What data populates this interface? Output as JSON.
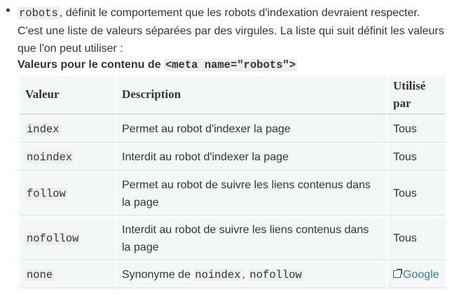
{
  "intro": {
    "code": "robots",
    "line1_rest": ", définit le comportement que les robots d'indexation devraient respecter.",
    "line2": "C'est une liste de valeurs séparées par des virgules. La liste qui suit définit les valeurs que l'on peut utiliser :"
  },
  "caption": {
    "prefix": "Valeurs pour le contenu de ",
    "code": "<meta name=\"robots\">"
  },
  "table": {
    "headers": [
      "Valeur",
      "Description",
      "Utilisé par"
    ],
    "rows": [
      {
        "value": "index",
        "description": "Permet au robot d'indexer la page",
        "used_by": "Tous"
      },
      {
        "value": "noindex",
        "description": "Interdit au robot d'indexer la page",
        "used_by": "Tous"
      },
      {
        "value": "follow",
        "description": "Permet au robot de suivre les liens contenus dans la page",
        "used_by": "Tous"
      },
      {
        "value": "nofollow",
        "description": "Interdit au robot de suivre les liens contenus dans la page",
        "used_by": "Tous"
      },
      {
        "value": "none",
        "description_prefix": "Synonyme de ",
        "description_code1": "noindex",
        "description_sep": ", ",
        "description_code2": "nofollow",
        "used_by_link": "Google",
        "used_by_icon": "external-link-icon"
      }
    ]
  }
}
